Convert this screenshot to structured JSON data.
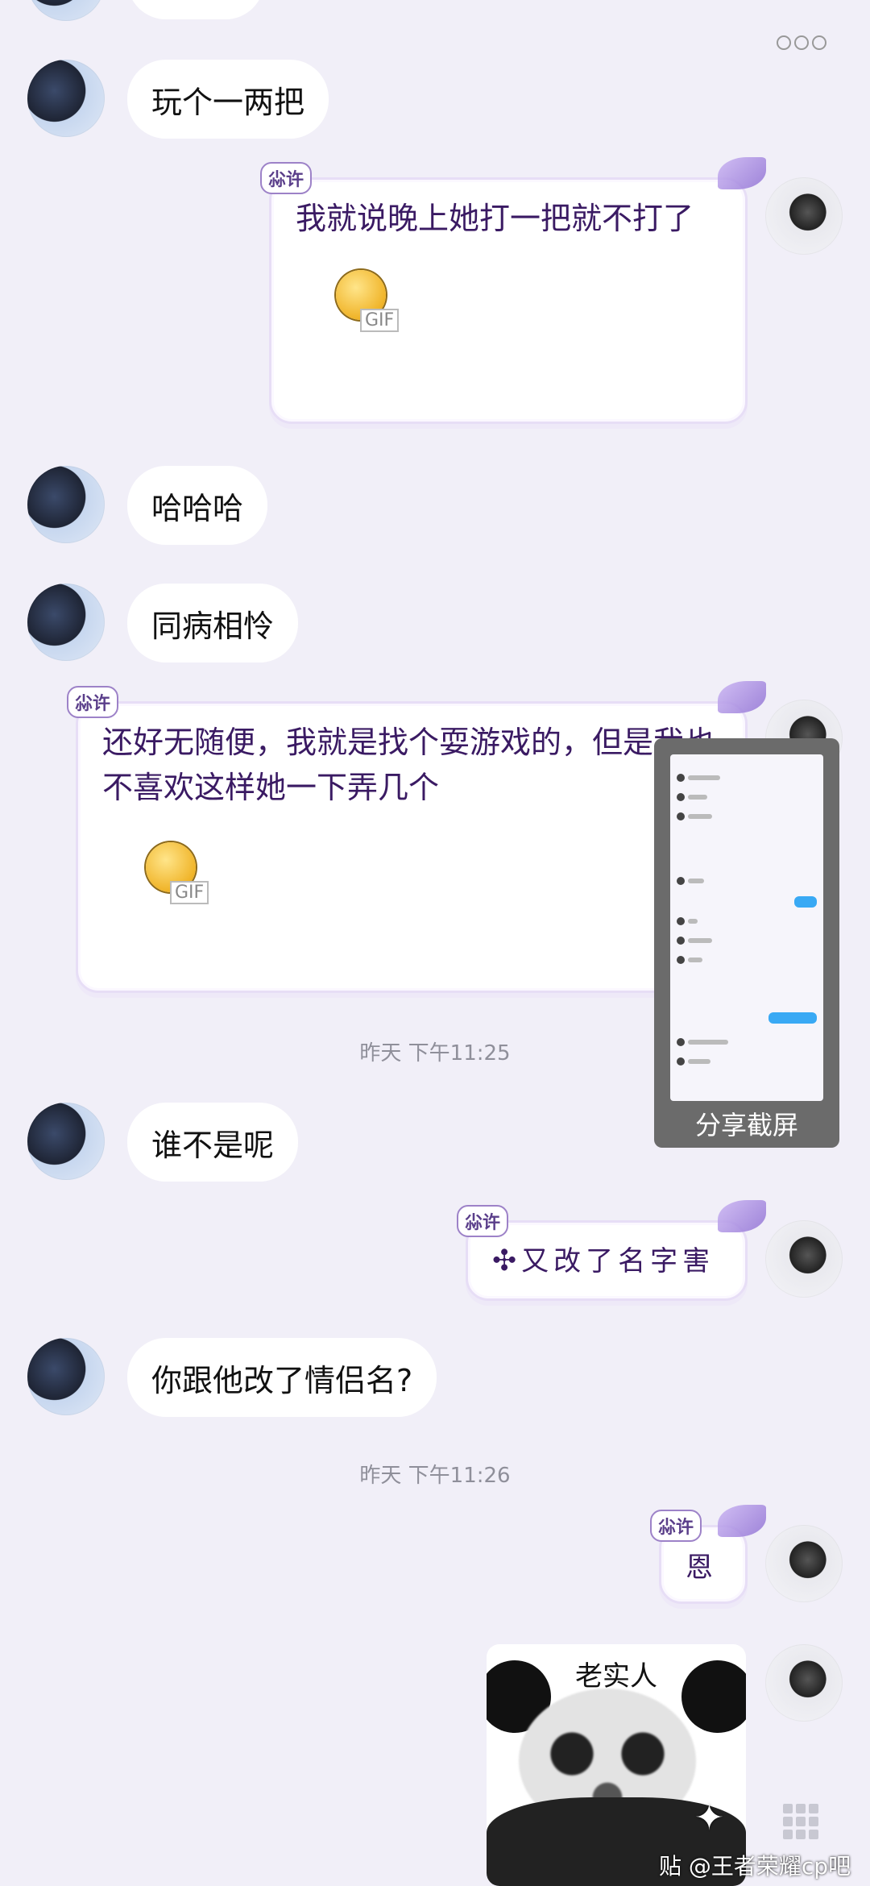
{
  "header": {
    "more_icon": "more-dots-icon"
  },
  "messages": [
    {
      "side": "left",
      "text": "玩个一两把"
    },
    {
      "side": "right",
      "tag": "尛许",
      "text": "我就说晚上她打一把就不打了",
      "gif_label": "GIF"
    },
    {
      "side": "left",
      "text": "哈哈哈"
    },
    {
      "side": "left",
      "text": "同病相怜"
    },
    {
      "side": "right",
      "tag": "尛许",
      "text": "还好无随便，我就是找个耍游戏的，但是我也不喜欢这样她一下弄几个",
      "gif_label": "GIF"
    },
    {
      "side": "left",
      "text": "谁不是呢"
    },
    {
      "side": "right",
      "tag": "尛许",
      "text": "又改了名字害"
    },
    {
      "side": "left",
      "text": "你跟他改了情侣名?"
    },
    {
      "side": "right",
      "tag": "尛许",
      "text": "恩"
    },
    {
      "side": "right",
      "sticker_caption": "老实人"
    }
  ],
  "timestamps": {
    "t1": "昨天 下午11:25",
    "t2": "昨天 下午11:26"
  },
  "share_screenshot": {
    "label": "分享截屏"
  },
  "watermark": {
    "text": "贴 @王者荣耀cp吧"
  },
  "colors": {
    "background": "#f1eff8",
    "vip_text": "#3a1a63",
    "thumb_accent": "#39a9f4"
  }
}
